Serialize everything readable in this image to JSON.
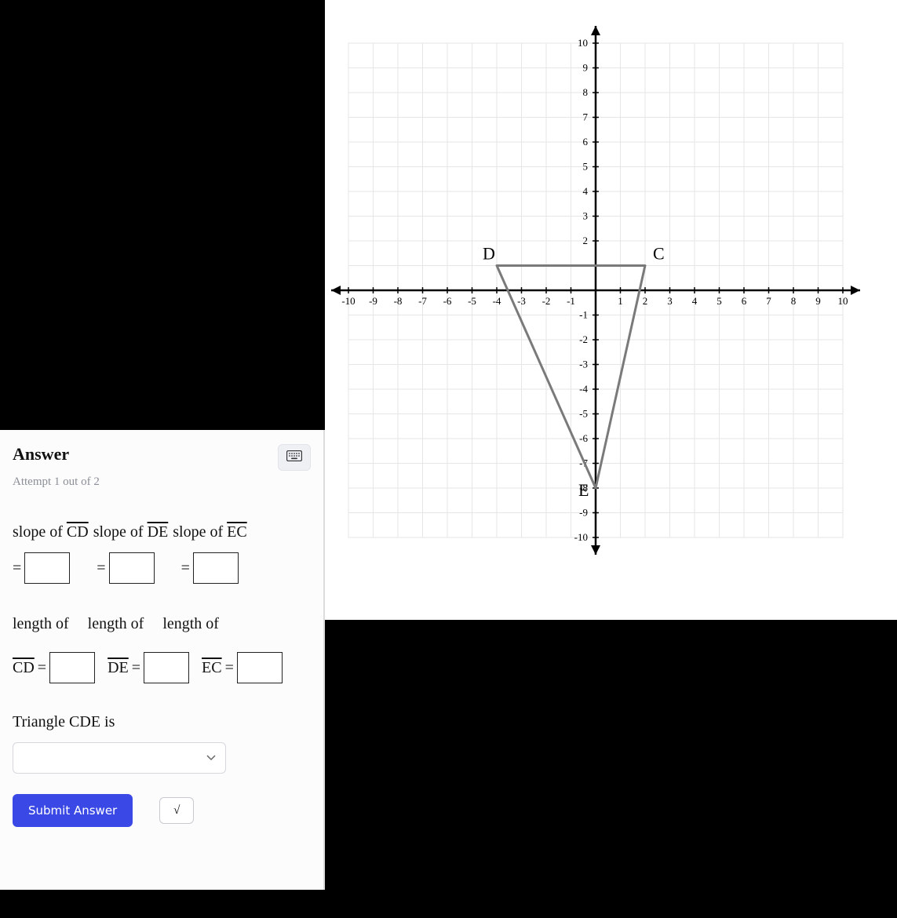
{
  "answer": {
    "title": "Answer",
    "attempt": "Attempt 1 out of 2",
    "slope_cd_label_prefix": "slope of ",
    "slope_de_label_prefix": "slope of ",
    "slope_ec_label_prefix": "slope of ",
    "seg_cd": "CD",
    "seg_de": "DE",
    "seg_ec": "EC",
    "equals": "=",
    "length_of": "length of",
    "triangle_label": "Triangle CDE is",
    "submit": "Submit Answer",
    "sqrt_symbol": "√"
  },
  "chart_data": {
    "type": "scatter",
    "title": "",
    "xlabel": "",
    "ylabel": "",
    "xlim": [
      -10,
      10
    ],
    "ylim": [
      -10,
      10
    ],
    "x_ticks": [
      -10,
      -9,
      -8,
      -7,
      -6,
      -5,
      -4,
      -3,
      -2,
      -1,
      1,
      2,
      3,
      4,
      5,
      6,
      7,
      8,
      9,
      10
    ],
    "y_ticks": [
      -10,
      -9,
      -8,
      -7,
      -6,
      -5,
      -4,
      -3,
      -2,
      -1,
      2,
      3,
      4,
      5,
      6,
      7,
      8,
      9,
      10
    ],
    "grid": true,
    "points": [
      {
        "name": "D",
        "x": -4,
        "y": 1
      },
      {
        "name": "C",
        "x": 2,
        "y": 1
      },
      {
        "name": "E",
        "x": 0,
        "y": -8
      }
    ],
    "segments": [
      {
        "from": "D",
        "to": "C"
      },
      {
        "from": "C",
        "to": "E"
      },
      {
        "from": "E",
        "to": "D"
      }
    ]
  }
}
